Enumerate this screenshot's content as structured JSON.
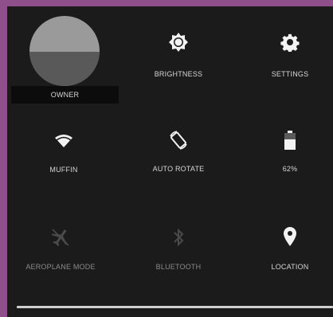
{
  "quick_settings": {
    "owner": {
      "label": "OWNER"
    },
    "brightness": {
      "label": "BRIGHTNESS",
      "icon": "brightness-icon"
    },
    "settings": {
      "label": "SETTINGS",
      "icon": "gear-icon"
    },
    "wifi": {
      "label": "MUFFIN",
      "icon": "wifi-icon"
    },
    "auto_rotate": {
      "label": "AUTO ROTATE",
      "icon": "rotate-icon"
    },
    "battery": {
      "label": "62%",
      "icon": "battery-icon",
      "level": 0.62
    },
    "airplane": {
      "label": "AEROPLANE MODE",
      "icon": "airplane-icon",
      "state": "off"
    },
    "bluetooth": {
      "label": "BLUETOOTH",
      "icon": "bluetooth-icon",
      "state": "off"
    },
    "location": {
      "label": "LOCATION",
      "icon": "location-pin-icon"
    }
  },
  "colors": {
    "background": "#8e4f8a",
    "panel": "#1b1b1b",
    "icon_active": "#f2f2f2",
    "icon_inactive": "#4a4a4a"
  }
}
